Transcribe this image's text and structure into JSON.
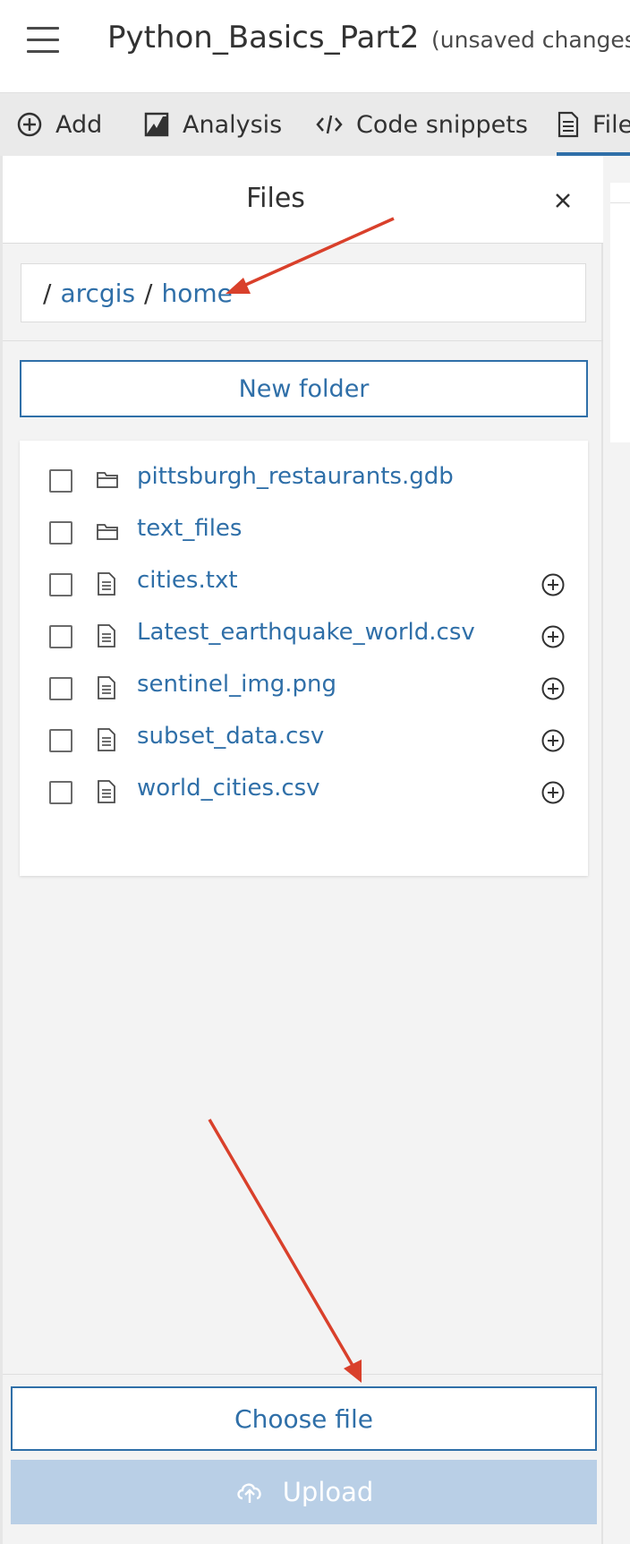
{
  "header": {
    "menu_icon": "hamburger-menu-icon",
    "title": "Python_Basics_Part2",
    "status": "(unsaved changes"
  },
  "toolbar": {
    "items": [
      {
        "label": "Add",
        "icon": "plus-circle-icon"
      },
      {
        "label": "Analysis",
        "icon": "analysis-icon"
      },
      {
        "label": "Code snippets",
        "icon": "code-icon"
      },
      {
        "label": "File",
        "icon": "file-icon",
        "active": true
      }
    ]
  },
  "files_panel": {
    "title": "Files",
    "close_icon": "close-icon",
    "breadcrumb": {
      "separator": "/",
      "items": [
        "arcgis",
        "home"
      ]
    },
    "new_folder_label": "New folder",
    "files": [
      {
        "name": "pittsburgh_restaurants.gdb",
        "type": "folder"
      },
      {
        "name": "text_files",
        "type": "folder"
      },
      {
        "name": "cities.txt",
        "type": "file",
        "addable": true
      },
      {
        "name": "Latest_earthquake_world.csv",
        "type": "file",
        "addable": true
      },
      {
        "name": "sentinel_img.png",
        "type": "file",
        "addable": true
      },
      {
        "name": "subset_data.csv",
        "type": "file",
        "addable": true
      },
      {
        "name": "world_cities.csv",
        "type": "file",
        "addable": true
      }
    ],
    "choose_file_label": "Choose file",
    "upload_label": "Upload",
    "upload_icon": "cloud-upload-icon"
  },
  "colors": {
    "accent": "#2f6fa8",
    "annotation_arrow": "#d9402b",
    "upload_disabled": "#b9cfe6"
  }
}
